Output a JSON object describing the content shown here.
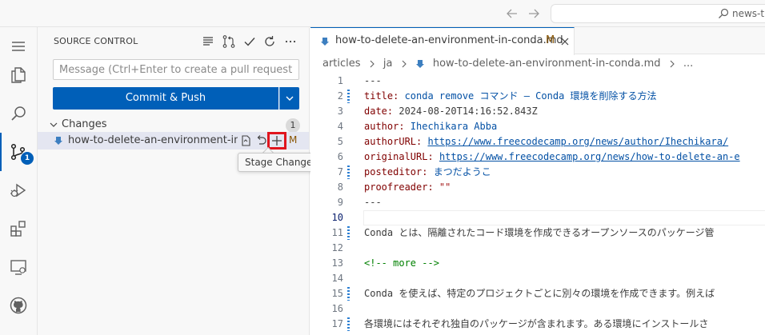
{
  "titlebar": {
    "search_text": "news-tr"
  },
  "activity_bar": {
    "items": [
      "menu",
      "explorer",
      "search",
      "source-control",
      "run-debug",
      "extensions",
      "remote-explorer",
      "github"
    ],
    "source_control_badge": "1"
  },
  "source_control": {
    "title": "SOURCE CONTROL",
    "message_placeholder": "Message (Ctrl+Enter to create a pull request for ...",
    "commit_button_label": "Commit & Push",
    "changes_label": "Changes",
    "changes_count": "1",
    "file": {
      "name": "how-to-delete-an-environment-in-...",
      "status": "M"
    },
    "tooltip": "Stage Changes"
  },
  "editor": {
    "tab": {
      "name": "how-to-delete-an-environment-in-conda.md",
      "status": "M"
    },
    "breadcrumb": {
      "parts": [
        "articles",
        "ja",
        "how-to-delete-an-environment-in-conda.md",
        "..."
      ]
    },
    "current_line": "10",
    "lines": [
      {
        "n": "1",
        "modified": false,
        "segs": [
          {
            "t": "---",
            "c": ""
          }
        ]
      },
      {
        "n": "2",
        "modified": true,
        "segs": [
          {
            "t": "title:",
            "c": "k"
          },
          {
            "t": " conda remove コマンド – Conda 環境を削除する方法",
            "c": "v"
          }
        ]
      },
      {
        "n": "3",
        "modified": false,
        "segs": [
          {
            "t": "date:",
            "c": "k"
          },
          {
            "t": " 2024-08-20T14:16:52.843Z",
            "c": ""
          }
        ]
      },
      {
        "n": "4",
        "modified": false,
        "segs": [
          {
            "t": "author:",
            "c": "k"
          },
          {
            "t": " Ihechikara Abba",
            "c": "v"
          }
        ]
      },
      {
        "n": "5",
        "modified": false,
        "segs": [
          {
            "t": "authorURL:",
            "c": "k"
          },
          {
            "t": " ",
            "c": ""
          },
          {
            "t": "https://www.freecodecamp.org/news/author/Ihechikara/",
            "c": "u"
          }
        ]
      },
      {
        "n": "6",
        "modified": false,
        "segs": [
          {
            "t": "originalURL:",
            "c": "k"
          },
          {
            "t": " ",
            "c": ""
          },
          {
            "t": "https://www.freecodecamp.org/news/how-to-delete-an-e",
            "c": "u"
          }
        ]
      },
      {
        "n": "7",
        "modified": true,
        "segs": [
          {
            "t": "posteditor:",
            "c": "k"
          },
          {
            "t": " まつだようこ",
            "c": "v"
          }
        ]
      },
      {
        "n": "8",
        "modified": false,
        "segs": [
          {
            "t": "proofreader:",
            "c": "k"
          },
          {
            "t": " \"\"",
            "c": "s"
          }
        ]
      },
      {
        "n": "9",
        "modified": false,
        "segs": [
          {
            "t": "---",
            "c": ""
          }
        ]
      },
      {
        "n": "10",
        "modified": false,
        "segs": [
          {
            "t": "",
            "c": ""
          }
        ]
      },
      {
        "n": "11",
        "modified": true,
        "segs": [
          {
            "t": "Conda とは、隔離されたコード環境を作成できるオープンソースのパッケージ管",
            "c": ""
          }
        ]
      },
      {
        "n": "12",
        "modified": false,
        "segs": [
          {
            "t": "",
            "c": ""
          }
        ]
      },
      {
        "n": "13",
        "modified": false,
        "segs": [
          {
            "t": "<!-- more -->",
            "c": "c"
          }
        ]
      },
      {
        "n": "14",
        "modified": false,
        "segs": [
          {
            "t": "",
            "c": ""
          }
        ]
      },
      {
        "n": "15",
        "modified": true,
        "segs": [
          {
            "t": "Conda を使えば、特定のプロジェクトごとに別々の環境を作成できます。例えば",
            "c": ""
          }
        ]
      },
      {
        "n": "16",
        "modified": false,
        "segs": [
          {
            "t": "",
            "c": ""
          }
        ]
      },
      {
        "n": "17",
        "modified": true,
        "segs": [
          {
            "t": "各環境にはそれぞれ独自のパッケージが含まれます。ある環境にインストールさ",
            "c": ""
          }
        ]
      }
    ]
  }
}
